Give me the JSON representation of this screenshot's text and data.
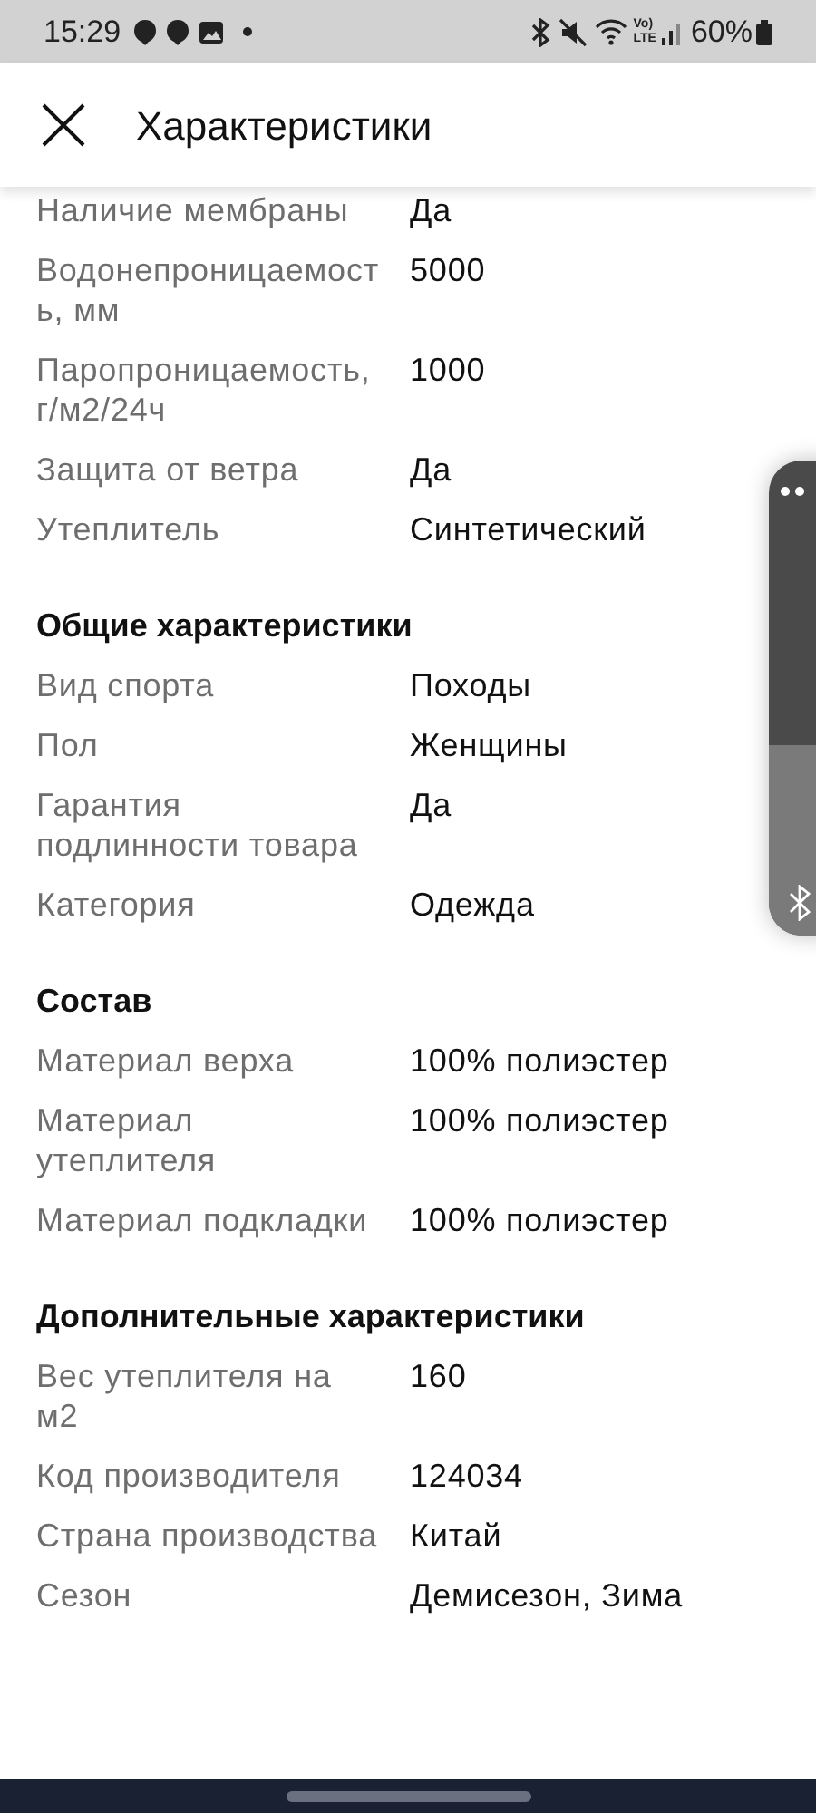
{
  "status_bar": {
    "time": "15:29",
    "network": [
      "Vo)",
      "LTE"
    ],
    "battery": "60%"
  },
  "header": {
    "title": "Характеристики"
  },
  "sections": [
    {
      "rows": [
        {
          "label": "Наличие мембраны",
          "value": "Да"
        },
        {
          "label": "Водонепроницаемость, мм",
          "value": "5000"
        },
        {
          "label": "Паропроницаемость, г/м2/24ч",
          "value": "1000"
        },
        {
          "label": "Защита от ветра",
          "value": "Да"
        },
        {
          "label": "Утеплитель",
          "value": "Синтетический"
        }
      ]
    },
    {
      "title": "Общие характеристики",
      "rows": [
        {
          "label": "Вид спорта",
          "value": "Походы"
        },
        {
          "label": "Пол",
          "value": "Женщины"
        },
        {
          "label": "Гарантия подлинности товара",
          "value": "Да"
        },
        {
          "label": "Категория",
          "value": "Одежда"
        }
      ]
    },
    {
      "title": "Состав",
      "rows": [
        {
          "label": "Материал верха",
          "value": "100% полиэстер"
        },
        {
          "label": "Материал утеплителя",
          "value": "100% полиэстер"
        },
        {
          "label": "Материал подкладки",
          "value": "100% полиэстер"
        }
      ]
    },
    {
      "title": "Дополнительные характеристики",
      "rows": [
        {
          "label": "Вес утеплителя на м2",
          "value": "160"
        },
        {
          "label": "Код производителя",
          "value": "124034"
        },
        {
          "label": "Страна производства",
          "value": "Китай"
        },
        {
          "label": "Сезон",
          "value": "Демисезон, Зима"
        }
      ]
    }
  ],
  "volume_panel": {
    "level": 0.4
  }
}
